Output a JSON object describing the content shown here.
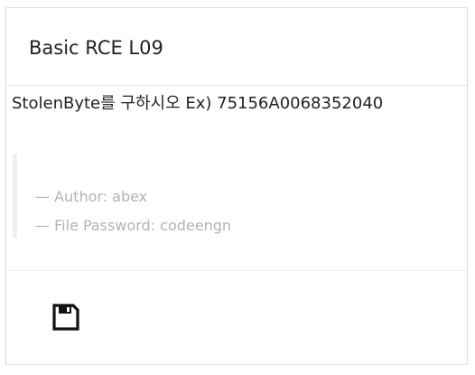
{
  "card": {
    "title": "Basic RCE L09",
    "question": "StolenByte를 구하시오 Ex) 75156A0068352040",
    "author_line": "— Author: abex",
    "password_line": "— File Password: codeengn"
  },
  "footer": {
    "save_icon": "floppy-disk-icon"
  }
}
